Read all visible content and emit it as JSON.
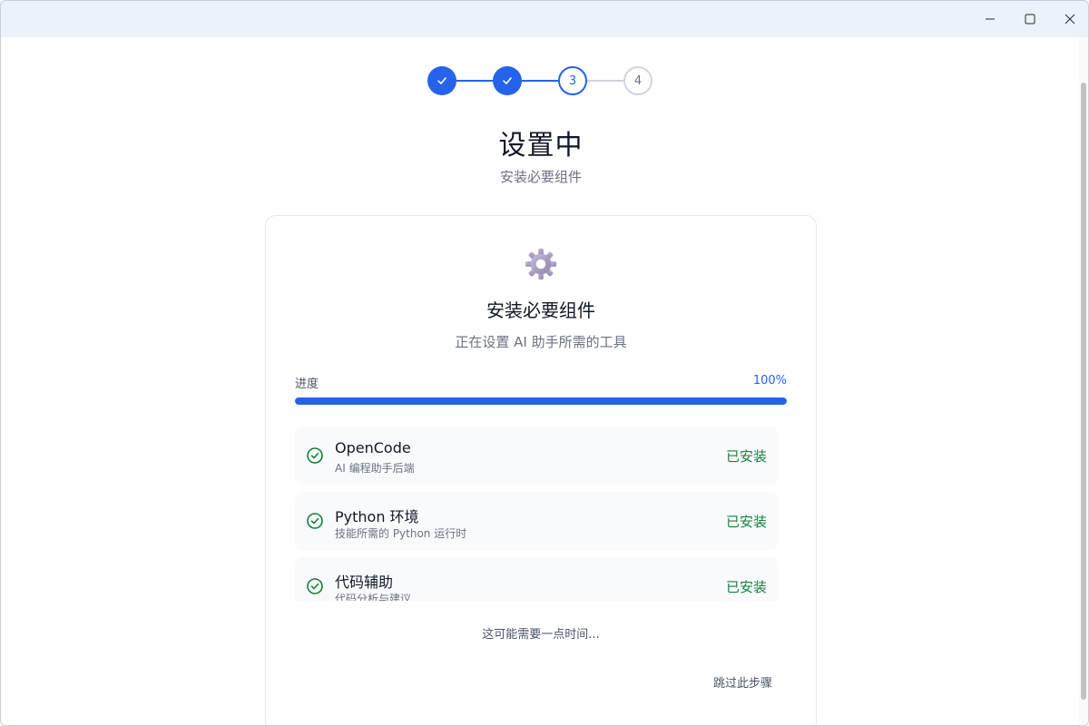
{
  "window": {
    "controls": [
      "minimize",
      "maximize",
      "close"
    ]
  },
  "stepper": {
    "steps": [
      {
        "label": "1",
        "state": "done"
      },
      {
        "label": "2",
        "state": "done"
      },
      {
        "label": "3",
        "state": "active"
      },
      {
        "label": "4",
        "state": "pending"
      }
    ]
  },
  "header": {
    "title": "设置中",
    "subtitle": "安装必要组件"
  },
  "card": {
    "icon": "gear-icon",
    "title": "安装必要组件",
    "subtitle": "正在设置 AI 助手所需的工具",
    "progress": {
      "label": "进度",
      "value_text": "100%",
      "fraction": 1.0
    },
    "components": [
      {
        "name": "OpenCode",
        "description": "AI 编程助手后端",
        "status": "已安装"
      },
      {
        "name": "Python 环境",
        "description": "技能所需的 Python 运行时",
        "status": "已安装"
      },
      {
        "name": "代码辅助",
        "description": "代码分析与建议",
        "status": "已安装"
      }
    ],
    "hint": "这可能需要一点时间...",
    "skip_label": "跳过此步骤"
  },
  "colors": {
    "accent": "#2563eb",
    "success": "#15803d",
    "titlebar": "#eaf2fa"
  }
}
